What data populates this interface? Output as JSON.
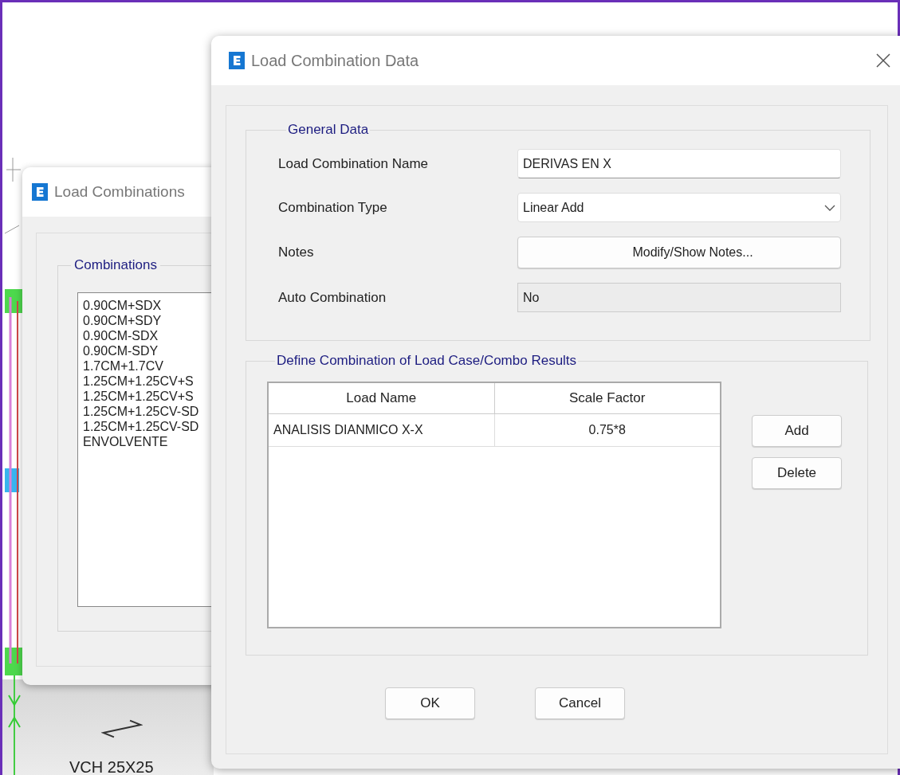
{
  "canvas": {
    "label": "VCH 25X25"
  },
  "back_dialog": {
    "title": "Load Combinations",
    "group": "Combinations",
    "combinations": [
      "0.90CM+SDX",
      "0.90CM+SDY",
      "0.90CM-SDX",
      "0.90CM-SDY",
      "1.7CM+1.7CV",
      "1.25CM+1.25CV+S",
      "1.25CM+1.25CV+S",
      "1.25CM+1.25CV-SD",
      "1.25CM+1.25CV-SD",
      "ENVOLVENTE"
    ]
  },
  "dialog": {
    "title": "Load Combination Data",
    "general": {
      "legend": "General Data",
      "fields": [
        {
          "kind": "text",
          "label": "Load Combination Name",
          "value": "DERIVAS EN X"
        },
        {
          "kind": "dropdown",
          "label": "Combination Type",
          "value": "Linear Add"
        },
        {
          "kind": "button",
          "label": "Notes",
          "value": "Modify/Show Notes..."
        },
        {
          "kind": "readonly",
          "label": "Auto Combination",
          "value": "No"
        }
      ]
    },
    "results": {
      "legend": "Define Combination of Load Case/Combo Results",
      "columns": [
        "Load Name",
        "Scale Factor"
      ],
      "rows": [
        [
          "ANALISIS DIANMICO X-X",
          "0.75*8"
        ]
      ],
      "buttons": [
        "Add",
        "Delete"
      ]
    },
    "buttons": [
      "OK",
      "Cancel"
    ]
  }
}
